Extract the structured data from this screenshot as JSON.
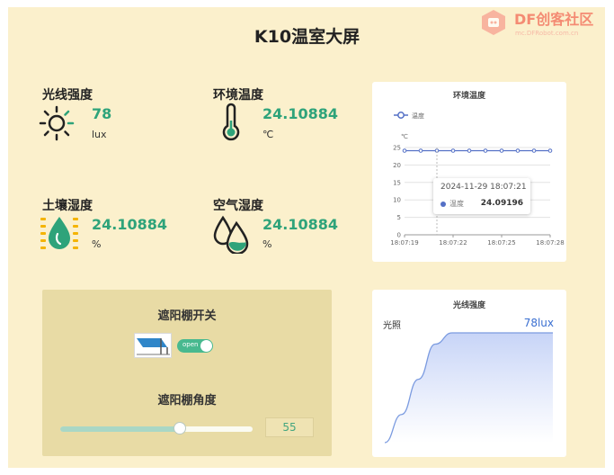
{
  "title": "K10温室大屏",
  "watermark": {
    "brand": "DF创客社区",
    "url": "mc.DFRobot.com.cn"
  },
  "sensors": {
    "light": {
      "label": "光线强度",
      "value": "78",
      "unit": "lux"
    },
    "temperature": {
      "label": "环境温度",
      "value": "24.10884",
      "unit": "℃"
    },
    "soil": {
      "label": "土壤湿度",
      "value": "24.10884",
      "unit": "%"
    },
    "air": {
      "label": "空气湿度",
      "value": "24.10884",
      "unit": "%"
    }
  },
  "temp_chart": {
    "title": "环境温度",
    "legend": "温度",
    "y_unit": "℃",
    "tooltip": {
      "time": "2024-11-29 18:07:21",
      "series": "温度",
      "value": "24.09196"
    }
  },
  "light_chart": {
    "title": "光线强度",
    "label": "光照",
    "value_text": "78lux"
  },
  "shade": {
    "switch_title": "遮阳棚开关",
    "toggle_label": "open",
    "toggle_on": true,
    "angle_title": "遮阳棚角度",
    "angle_value": "55",
    "angle_fraction": 0.62
  },
  "colors": {
    "accent": "#2ea37a",
    "line": "#5470c6",
    "background": "#fbf0cc",
    "panel": "#e8dba5"
  },
  "chart_data": [
    {
      "type": "line",
      "title": "环境温度",
      "ylabel": "℃",
      "ylim": [
        0,
        25
      ],
      "yticks": [
        0,
        5,
        10,
        15,
        20,
        25
      ],
      "x_tick_labels": [
        "18:07:19",
        "18:07:22",
        "18:07:25",
        "18:07:28"
      ],
      "series": [
        {
          "name": "温度",
          "values": [
            24.1,
            24.1,
            24.1,
            24.1,
            24.09,
            24.1,
            24.1,
            24.1,
            24.1,
            24.1
          ]
        }
      ],
      "grid": true,
      "legend": "top-left"
    },
    {
      "type": "area",
      "title": "光线强度",
      "values": [
        0,
        20,
        45,
        70,
        78,
        78,
        78,
        78,
        78,
        78,
        78
      ]
    }
  ]
}
